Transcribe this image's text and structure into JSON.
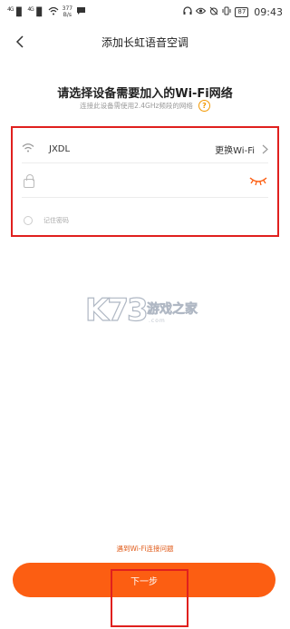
{
  "status_bar": {
    "signal1": "4G",
    "signal2": "4G",
    "speed_value": "377",
    "speed_unit": "B/s",
    "battery": "87",
    "time": "09:43"
  },
  "nav": {
    "back_icon": "chevron-left",
    "title": "添加长虹语音空调"
  },
  "page": {
    "heading": "请选择设备需要加入的Wi-Fi网络",
    "subheading": "连接此设备需使用2.4GHz频段的网络",
    "help_symbol": "?"
  },
  "form": {
    "ssid": "JXDL",
    "change_wifi_label": "更换Wi-Fi",
    "password_value": "",
    "password_placeholder": "",
    "remember_label": "记住密码"
  },
  "watermark": {
    "logo_text": "K73",
    "site_text": "游戏之家",
    "site_sub": ".com"
  },
  "footer": {
    "help_link": "遇到Wi-Fi连接问题",
    "next_button": "下一步"
  },
  "colors": {
    "accent": "#fc5e12",
    "highlight_box": "#e0201e",
    "help_icon": "#f39800"
  }
}
